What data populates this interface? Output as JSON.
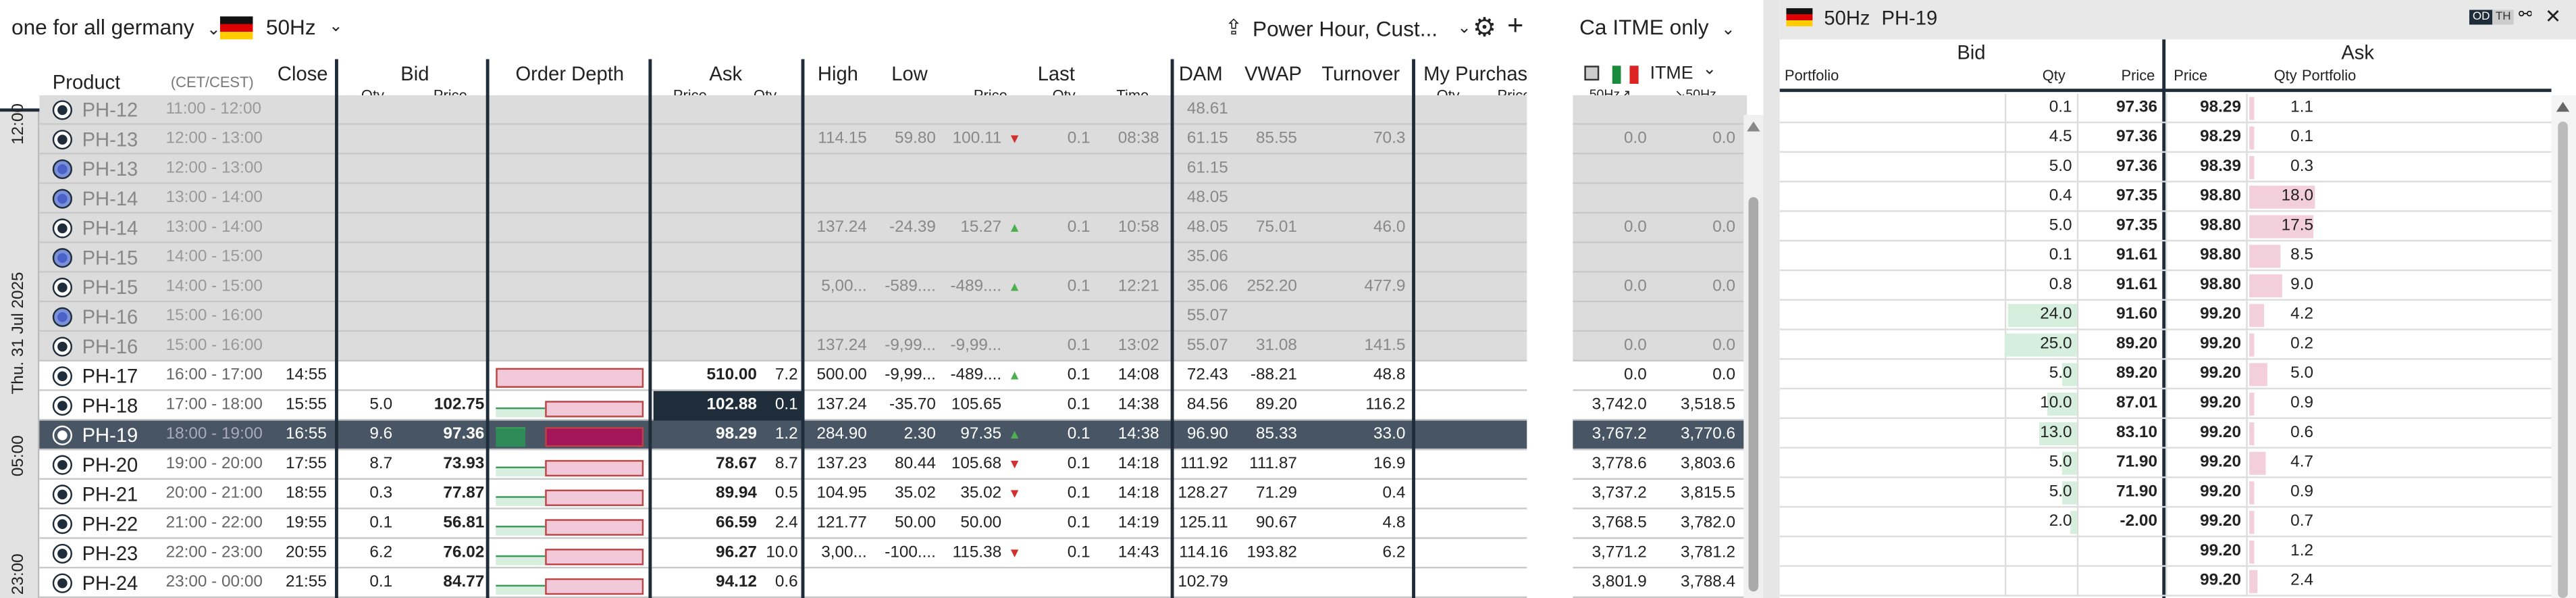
{
  "topbar": {
    "market": "one for all germany",
    "freq": "50Hz",
    "strategy": "Power Hour, Cust...",
    "mid_label_a": "Ca",
    "mid_label_b": "ITME only"
  },
  "cols": {
    "product": "Product",
    "cet": "(CET/CEST)",
    "close": "Close",
    "bid": "Bid",
    "qty": "Qty",
    "price": "Price",
    "depth": "Order Depth",
    "ask": "Ask",
    "high": "High",
    "low": "Low",
    "last": "Last",
    "time": "Time",
    "dam": "DAM",
    "vwap": "VWAP",
    "turnover": "Turnover",
    "mypurch": "My Purchase",
    "itme": "ITME",
    "hz1": "50Hz",
    "hz2": "50Hz"
  },
  "side": {
    "date": "Thu. 31 Jul 2025",
    "h12": "12:00",
    "h05": "05:00",
    "h23": "23:00"
  },
  "rows": [
    {
      "p": "PH-12",
      "t": "11:00 - 12:00",
      "cl": "",
      "bq": "",
      "bp": "",
      "ap": "",
      "aq": "",
      "hi": "",
      "lo": "",
      "lp": "",
      "lt": "",
      "lq": "",
      "tm": "",
      "dam": "48.61",
      "vw": "",
      "to": "",
      "i1": "",
      "i2": "",
      "st": "old"
    },
    {
      "p": "PH-13",
      "t": "12:00 - 13:00",
      "cl": "",
      "bq": "",
      "bp": "",
      "ap": "",
      "aq": "",
      "hi": "114.15",
      "lo": "59.80",
      "lp": "100.11",
      "lt": "dn",
      "lq": "0.1",
      "tm": "08:38",
      "dam": "61.15",
      "vw": "85.55",
      "to": "70.3",
      "i1": "0.0",
      "i2": "0.0",
      "st": "old"
    },
    {
      "p": "PH-13",
      "t": "12:00 - 13:00",
      "cl": "",
      "bq": "",
      "bp": "",
      "ap": "",
      "aq": "",
      "hi": "",
      "lo": "",
      "lp": "",
      "lt": "",
      "lq": "",
      "tm": "",
      "dam": "61.15",
      "vw": "",
      "to": "",
      "i1": "",
      "i2": "",
      "st": "blue"
    },
    {
      "p": "PH-14",
      "t": "13:00 - 14:00",
      "cl": "",
      "bq": "",
      "bp": "",
      "ap": "",
      "aq": "",
      "hi": "",
      "lo": "",
      "lp": "",
      "lt": "",
      "lq": "",
      "tm": "",
      "dam": "48.05",
      "vw": "",
      "to": "",
      "i1": "",
      "i2": "",
      "st": "blue"
    },
    {
      "p": "PH-14",
      "t": "13:00 - 14:00",
      "cl": "",
      "bq": "",
      "bp": "",
      "ap": "",
      "aq": "",
      "hi": "137.24",
      "lo": "-24.39",
      "lp": "15.27",
      "lt": "up",
      "lq": "0.1",
      "tm": "10:58",
      "dam": "48.05",
      "vw": "75.01",
      "to": "46.0",
      "i1": "0.0",
      "i2": "0.0",
      "st": "old"
    },
    {
      "p": "PH-15",
      "t": "14:00 - 15:00",
      "cl": "",
      "bq": "",
      "bp": "",
      "ap": "",
      "aq": "",
      "hi": "",
      "lo": "",
      "lp": "",
      "lt": "",
      "lq": "",
      "tm": "",
      "dam": "35.06",
      "vw": "",
      "to": "",
      "i1": "",
      "i2": "",
      "st": "blue"
    },
    {
      "p": "PH-15",
      "t": "14:00 - 15:00",
      "cl": "",
      "bq": "",
      "bp": "",
      "ap": "",
      "aq": "",
      "hi": "5,00...",
      "lo": "-589....",
      "lp": "-489....",
      "lt": "up",
      "lq": "0.1",
      "tm": "12:21",
      "dam": "35.06",
      "vw": "252.20",
      "to": "477.9",
      "i1": "0.0",
      "i2": "0.0",
      "st": "old"
    },
    {
      "p": "PH-16",
      "t": "15:00 - 16:00",
      "cl": "",
      "bq": "",
      "bp": "",
      "ap": "",
      "aq": "",
      "hi": "",
      "lo": "",
      "lp": "",
      "lt": "",
      "lq": "",
      "tm": "",
      "dam": "55.07",
      "vw": "",
      "to": "",
      "i1": "",
      "i2": "",
      "st": "blue"
    },
    {
      "p": "PH-16",
      "t": "15:00 - 16:00",
      "cl": "",
      "bq": "",
      "bp": "",
      "ap": "",
      "aq": "",
      "hi": "137.24",
      "lo": "-9,99...",
      "lp": "-9,99...",
      "lt": "",
      "lq": "0.1",
      "tm": "13:02",
      "dam": "55.07",
      "vw": "31.08",
      "to": "141.5",
      "i1": "0.0",
      "i2": "0.0",
      "st": "old"
    },
    {
      "p": "PH-17",
      "t": "16:00 - 17:00",
      "cl": "14:55",
      "bq": "",
      "bp": "",
      "ap": "510.00",
      "aq": "7.2",
      "hi": "500.00",
      "lo": "-9,99...",
      "lp": "-489....",
      "lt": "up",
      "lq": "0.1",
      "tm": "14:08",
      "dam": "72.43",
      "vw": "-88.21",
      "to": "48.8",
      "i1": "0.0",
      "i2": "0.0",
      "st": "live"
    },
    {
      "p": "PH-18",
      "t": "17:00 - 18:00",
      "cl": "15:55",
      "bq": "5.0",
      "bp": "102.75",
      "ap": "102.88",
      "aq": "0.1",
      "hi": "137.24",
      "lo": "-35.70",
      "lp": "105.65",
      "lt": "",
      "lq": "0.1",
      "tm": "14:38",
      "dam": "84.56",
      "vw": "89.20",
      "to": "116.2",
      "i1": "3,742.0",
      "i2": "3,518.5",
      "st": "live"
    },
    {
      "p": "PH-19",
      "t": "18:00 - 19:00",
      "cl": "16:55",
      "bq": "9.6",
      "bp": "97.36",
      "ap": "98.29",
      "aq": "1.2",
      "hi": "284.90",
      "lo": "2.30",
      "lp": "97.35",
      "lt": "up",
      "lq": "0.1",
      "tm": "14:38",
      "dam": "96.90",
      "vw": "85.33",
      "to": "33.0",
      "i1": "3,767.2",
      "i2": "3,770.6",
      "st": "sel"
    },
    {
      "p": "PH-20",
      "t": "19:00 - 20:00",
      "cl": "17:55",
      "bq": "8.7",
      "bp": "73.93",
      "ap": "78.67",
      "aq": "8.7",
      "hi": "137.23",
      "lo": "80.44",
      "lp": "105.68",
      "lt": "dn",
      "lq": "0.1",
      "tm": "14:18",
      "dam": "111.92",
      "vw": "111.87",
      "to": "16.9",
      "i1": "3,778.6",
      "i2": "3,803.6",
      "st": "live"
    },
    {
      "p": "PH-21",
      "t": "20:00 - 21:00",
      "cl": "18:55",
      "bq": "0.3",
      "bp": "77.87",
      "ap": "89.94",
      "aq": "0.5",
      "hi": "104.95",
      "lo": "35.02",
      "lp": "35.02",
      "lt": "dn",
      "lq": "0.1",
      "tm": "14:18",
      "dam": "128.27",
      "vw": "71.29",
      "to": "0.4",
      "i1": "3,737.2",
      "i2": "3,815.5",
      "st": "live"
    },
    {
      "p": "PH-22",
      "t": "21:00 - 22:00",
      "cl": "19:55",
      "bq": "0.1",
      "bp": "56.81",
      "ap": "66.59",
      "aq": "2.4",
      "hi": "121.77",
      "lo": "50.00",
      "lp": "50.00",
      "lt": "",
      "lq": "0.1",
      "tm": "14:19",
      "dam": "125.11",
      "vw": "90.67",
      "to": "4.8",
      "i1": "3,768.5",
      "i2": "3,782.0",
      "st": "live"
    },
    {
      "p": "PH-23",
      "t": "22:00 - 23:00",
      "cl": "20:55",
      "bq": "6.2",
      "bp": "76.02",
      "ap": "96.27",
      "aq": "10.0",
      "hi": "3,00...",
      "lo": "-100....",
      "lp": "115.38",
      "lt": "dn",
      "lq": "0.1",
      "tm": "14:43",
      "dam": "114.16",
      "vw": "193.82",
      "to": "6.2",
      "i1": "3,771.2",
      "i2": "3,781.2",
      "st": "live"
    },
    {
      "p": "PH-24",
      "t": "23:00 - 00:00",
      "cl": "21:55",
      "bq": "0.1",
      "bp": "84.77",
      "ap": "94.12",
      "aq": "0.6",
      "hi": "",
      "lo": "",
      "lp": "",
      "lt": "",
      "lq": "",
      "tm": "",
      "dam": "102.79",
      "vw": "",
      "to": "",
      "i1": "3,801.9",
      "i2": "3,788.4",
      "st": "live"
    }
  ],
  "right": {
    "freq": "50Hz",
    "product": "PH-19",
    "bid": "Bid",
    "ask": "Ask",
    "portfolio": "Portfolio",
    "qty": "Qty",
    "price": "Price",
    "badge_od": "OD",
    "badge_th": "TH",
    "book": [
      {
        "bq": "0.1",
        "bp": "97.36",
        "ap": "98.29",
        "aq": "1.1",
        "bbar": 0,
        "abar": 0.05
      },
      {
        "bq": "4.5",
        "bp": "97.36",
        "ap": "98.29",
        "aq": "0.1",
        "bbar": 0,
        "abar": 0.05
      },
      {
        "bq": "5.0",
        "bp": "97.36",
        "ap": "98.39",
        "aq": "0.3",
        "bbar": 0,
        "abar": 0.05
      },
      {
        "bq": "0.4",
        "bp": "97.35",
        "ap": "98.80",
        "aq": "18.0",
        "bbar": 0,
        "abar": 1.0
      },
      {
        "bq": "5.0",
        "bp": "97.35",
        "ap": "98.80",
        "aq": "17.5",
        "bbar": 0,
        "abar": 0.97
      },
      {
        "bq": "0.1",
        "bp": "91.61",
        "ap": "98.80",
        "aq": "8.5",
        "bbar": 0,
        "abar": 0.47
      },
      {
        "bq": "0.8",
        "bp": "91.61",
        "ap": "98.80",
        "aq": "9.0",
        "bbar": 0,
        "abar": 0.5
      },
      {
        "bq": "24.0",
        "bp": "91.60",
        "ap": "99.20",
        "aq": "4.2",
        "bbar": 0.96,
        "abar": 0.23
      },
      {
        "bq": "25.0",
        "bp": "89.20",
        "ap": "99.20",
        "aq": "0.2",
        "bbar": 1.0,
        "abar": 0.05
      },
      {
        "bq": "5.0",
        "bp": "89.20",
        "ap": "99.20",
        "aq": "5.0",
        "bbar": 0.2,
        "abar": 0.28
      },
      {
        "bq": "10.0",
        "bp": "87.01",
        "ap": "99.20",
        "aq": "0.9",
        "bbar": 0.4,
        "abar": 0.05
      },
      {
        "bq": "13.0",
        "bp": "83.10",
        "ap": "99.20",
        "aq": "0.6",
        "bbar": 0.52,
        "abar": 0.05
      },
      {
        "bq": "5.0",
        "bp": "71.90",
        "ap": "99.20",
        "aq": "4.7",
        "bbar": 0.2,
        "abar": 0.26
      },
      {
        "bq": "5.0",
        "bp": "71.90",
        "ap": "99.20",
        "aq": "0.9",
        "bbar": 0.2,
        "abar": 0.05
      },
      {
        "bq": "2.0",
        "bp": "-2.00",
        "ap": "99.20",
        "aq": "0.7",
        "bbar": 0.08,
        "abar": 0.05
      },
      {
        "bq": "",
        "bp": "",
        "ap": "99.20",
        "aq": "1.2",
        "bbar": 0,
        "abar": 0.07
      },
      {
        "bq": "",
        "bp": "",
        "ap": "99.20",
        "aq": "2.4",
        "bbar": 0,
        "abar": 0.13
      }
    ]
  }
}
